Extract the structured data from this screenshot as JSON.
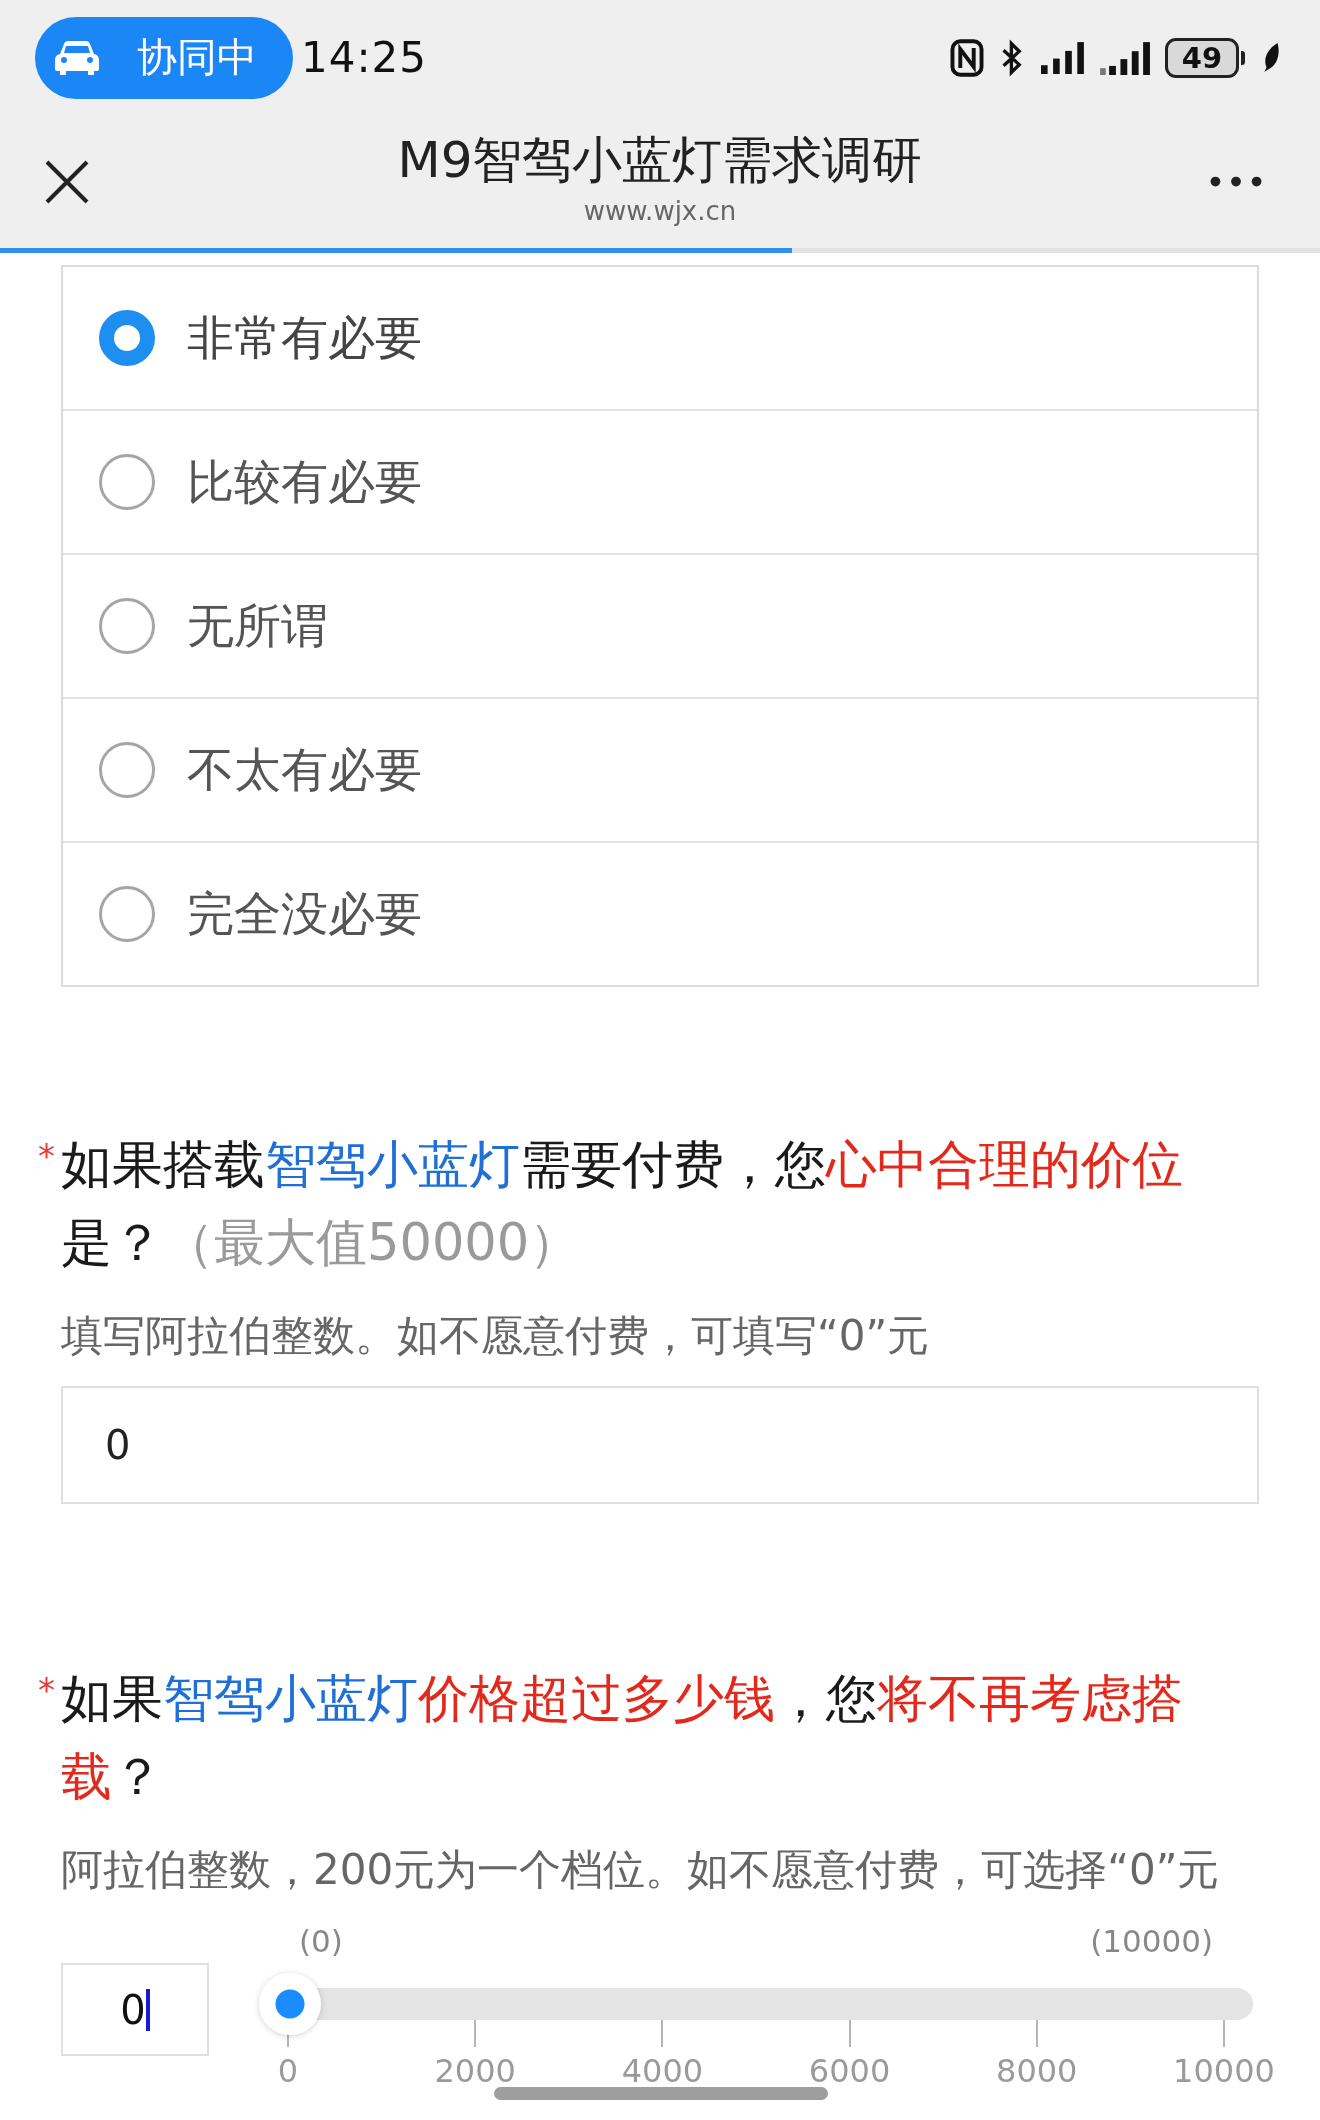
{
  "status_bar": {
    "chip": {
      "label": "协同中"
    },
    "time": "14:25",
    "battery": "49"
  },
  "header": {
    "title": "M9智驾小蓝灯需求调研",
    "url": "www.wjx.cn",
    "progress": {
      "level": 0.6
    }
  },
  "options": [
    {
      "label": "非常有必要",
      "selected": true
    },
    {
      "label": "比较有必要",
      "selected": false
    },
    {
      "label": "无所谓",
      "selected": false
    },
    {
      "label": "不太有必要",
      "selected": false
    },
    {
      "label": "完全没必要",
      "selected": false
    }
  ],
  "questions": [
    {
      "kind": "text",
      "marker": "*",
      "title": [
        {
          "text": "如果搭载",
          "color": "#1a1a1a"
        },
        {
          "text": "智驾小蓝灯",
          "color": "#1f6fd6"
        },
        {
          "text": "需要付费，您",
          "color": "#1a1a1a"
        },
        {
          "text": "心中合理的价位",
          "color": "#e3291c"
        },
        {
          "text": "是？",
          "color": "#1a1a1a"
        },
        {
          "text": "（最大值50000）",
          "color": "#9a9a9a"
        }
      ],
      "hint": "填写阿拉伯整数。如不愿意付费，可填写“0”元",
      "answer": {
        "value": "0"
      }
    },
    {
      "kind": "slider",
      "marker": "*",
      "title": [
        {
          "text": "如果",
          "color": "#1a1a1a"
        },
        {
          "text": "智驾小蓝灯",
          "color": "#1f6fd6"
        },
        {
          "text": "价格超过多少钱",
          "color": "#e3291c"
        },
        {
          "text": "，您",
          "color": "#1a1a1a"
        },
        {
          "text": "将不再考虑搭载",
          "color": "#e3291c"
        },
        {
          "text": "？",
          "color": "#1a1a1a"
        }
      ],
      "hint": "阿拉伯整数，200元为一个档位。如不愿意付费，可选择“0”元",
      "slider": {
        "value": "0",
        "focused": true,
        "min_label": "(0)",
        "max_label": "(10000)",
        "level": 0,
        "ticks": [
          "0",
          "2000",
          "4000",
          "6000",
          "8000",
          "10000"
        ]
      }
    }
  ],
  "gesture_bar": true
}
